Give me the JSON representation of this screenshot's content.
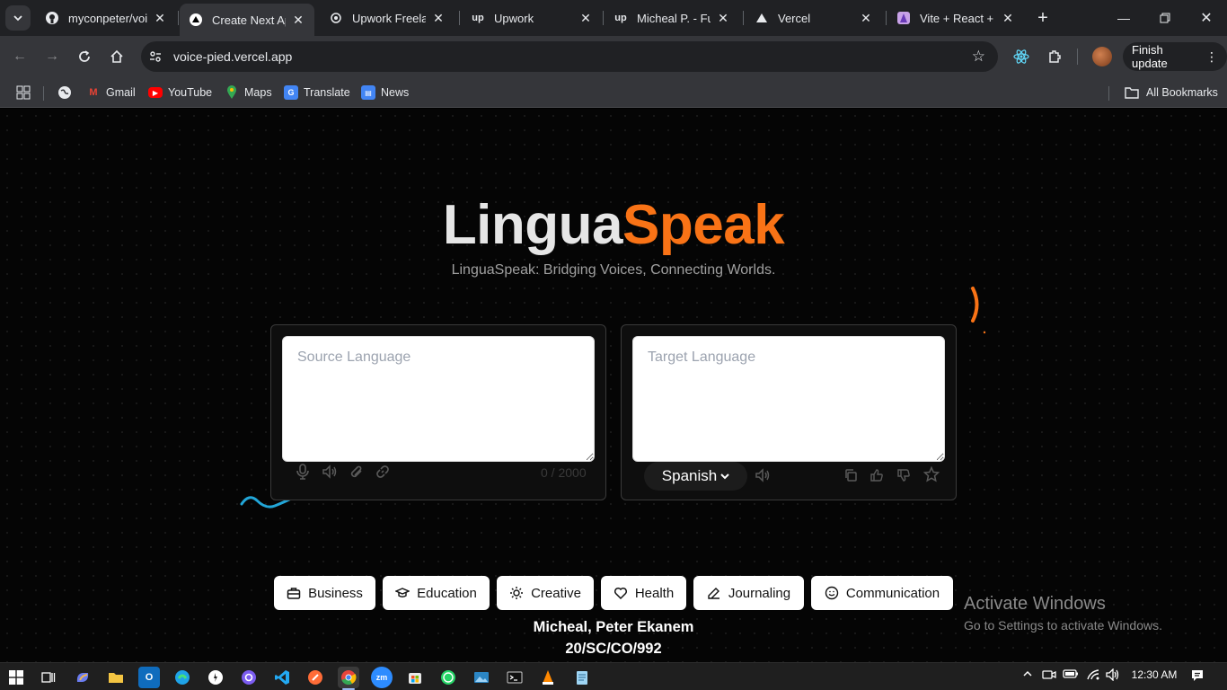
{
  "browser": {
    "tabs": [
      {
        "label": "myconpeter/voic",
        "icon": "github-icon"
      },
      {
        "label": "Create Next App",
        "icon": "triangle-icon"
      },
      {
        "label": "Upwork Freelanc",
        "icon": "openai-icon"
      },
      {
        "label": "Upwork",
        "icon": "upwork-icon"
      },
      {
        "label": "Micheal P. - Full",
        "icon": "upwork-icon"
      },
      {
        "label": "Vercel",
        "icon": "triangle-icon"
      },
      {
        "label": "Vite + React + T",
        "icon": "vite-icon"
      }
    ],
    "url": "voice-pied.vercel.app",
    "finish_update_label": "Finish update",
    "bookmarks": [
      {
        "label": "Gmail",
        "icon": "gmail-icon",
        "color": "#ea4335"
      },
      {
        "label": "YouTube",
        "icon": "youtube-icon",
        "color": "#ff0000"
      },
      {
        "label": "Maps",
        "icon": "maps-icon",
        "color": "#34a853"
      },
      {
        "label": "Translate",
        "icon": "translate-icon",
        "color": "#4285f4"
      },
      {
        "label": "News",
        "icon": "news-icon",
        "color": "#4285f4"
      }
    ],
    "all_bookmarks_label": "All Bookmarks"
  },
  "app": {
    "brand_part1": "Lingua",
    "brand_part2": "Speak",
    "tagline": "LinguaSpeak: Bridging Voices, Connecting Worlds.",
    "source": {
      "placeholder": "Source Language",
      "char_count": "0 / 2000",
      "icons": [
        "microphone-icon",
        "speaker-icon",
        "paperclip-icon",
        "link-icon"
      ]
    },
    "target": {
      "placeholder": "Target Language",
      "language": "Spanish",
      "icons": [
        "speaker-icon",
        "copy-icon",
        "thumbs-up-icon",
        "thumbs-down-icon",
        "star-icon"
      ]
    },
    "categories": [
      {
        "label": "Business",
        "icon": "briefcase-icon"
      },
      {
        "label": "Education",
        "icon": "graduation-cap-icon"
      },
      {
        "label": "Creative",
        "icon": "lightbulb-icon"
      },
      {
        "label": "Health",
        "icon": "heart-icon"
      },
      {
        "label": "Journaling",
        "icon": "pen-icon"
      },
      {
        "label": "Communication",
        "icon": "smile-icon"
      }
    ],
    "author_name": "Micheal, Peter Ekanem",
    "author_id": "20/SC/CO/992",
    "accent_color": "#f97316"
  },
  "watermark": {
    "title": "Activate Windows",
    "subtitle": "Go to Settings to activate Windows."
  },
  "taskbar": {
    "time": "12:30 AM"
  }
}
